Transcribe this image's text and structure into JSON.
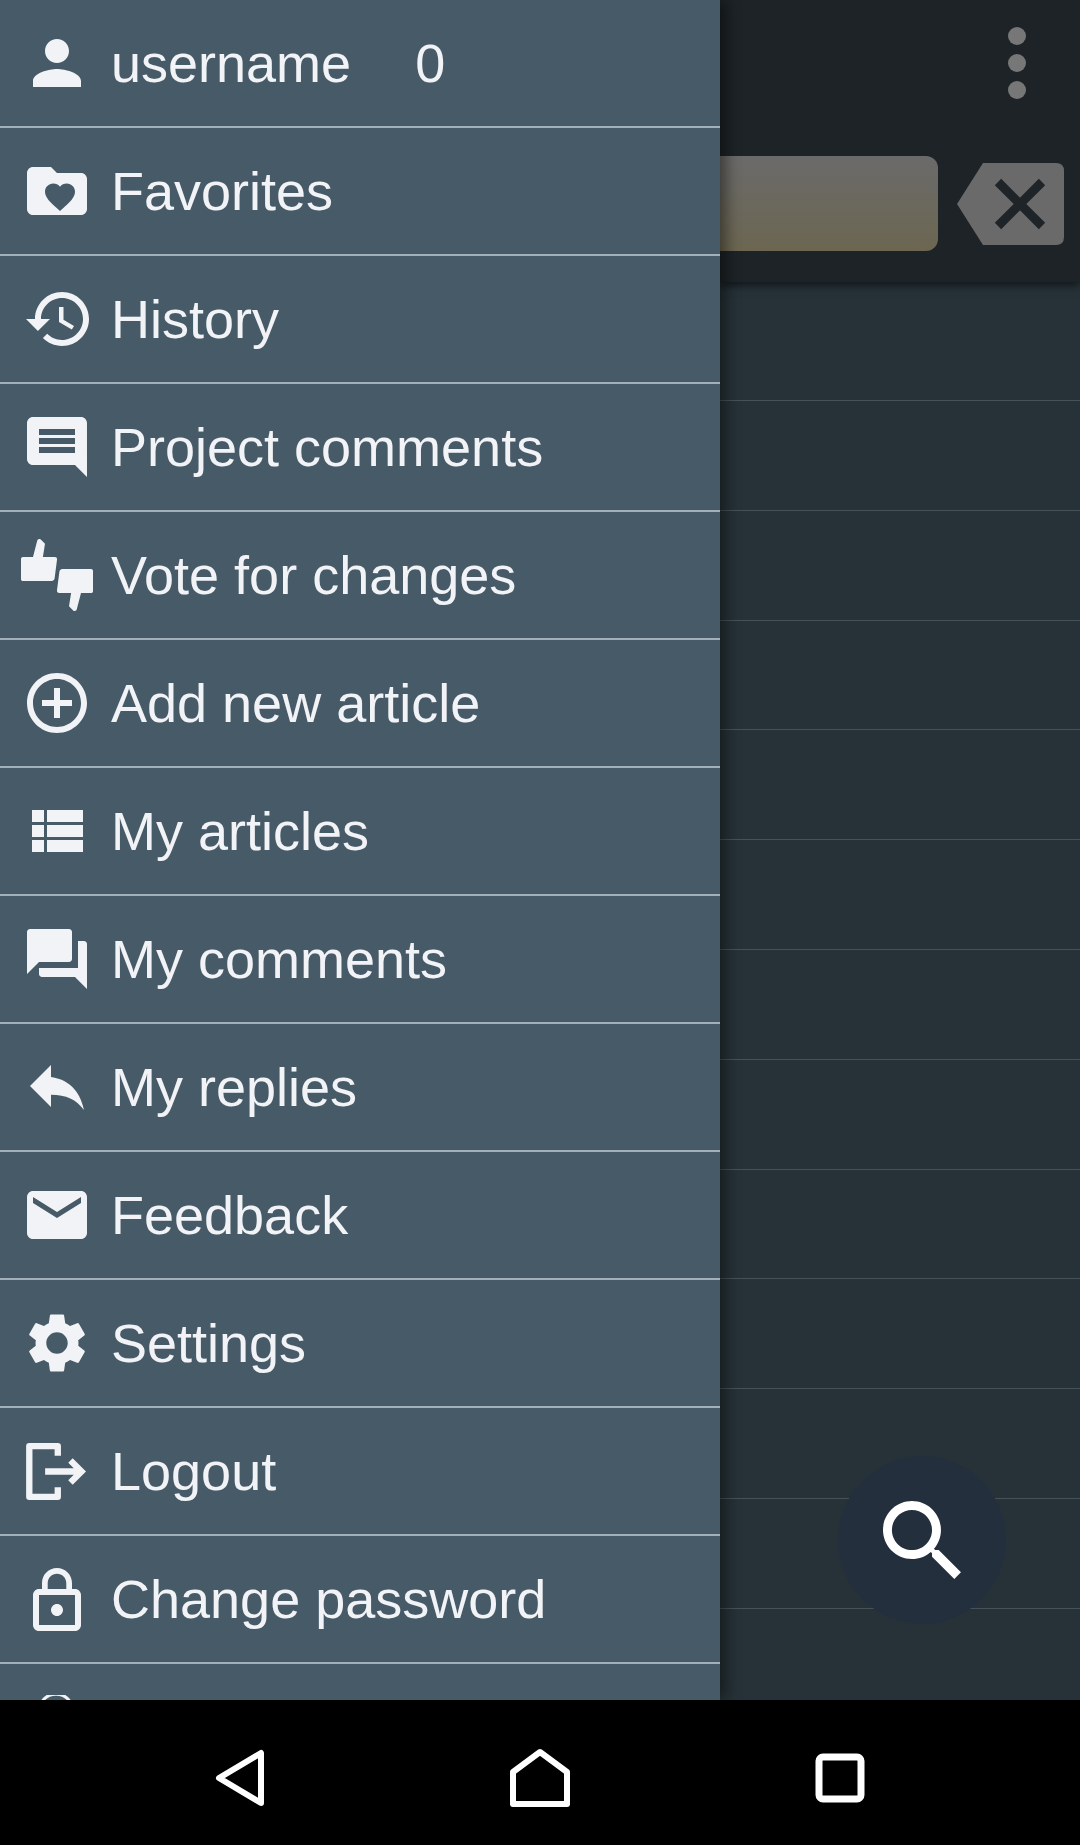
{
  "drawer": {
    "account": {
      "name": "username",
      "count": "0"
    },
    "items": [
      {
        "label": "Favorites"
      },
      {
        "label": "History"
      },
      {
        "label": "Project comments"
      },
      {
        "label": "Vote for changes"
      },
      {
        "label": "Add new article"
      },
      {
        "label": "My articles"
      },
      {
        "label": "My comments"
      },
      {
        "label": "My replies"
      },
      {
        "label": "Feedback"
      },
      {
        "label": "Settings"
      },
      {
        "label": "Logout"
      },
      {
        "label": "Change password"
      }
    ]
  }
}
